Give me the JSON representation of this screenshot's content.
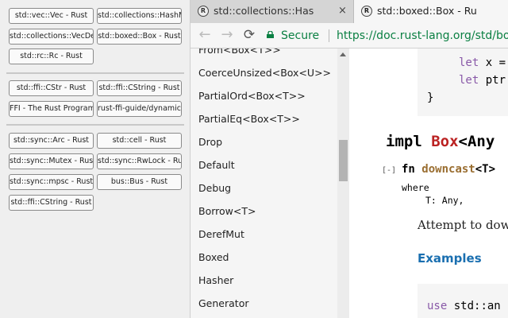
{
  "tab_manager": {
    "group1": [
      "std::vec::Vec - Rust",
      "std::collections::HashMap",
      "std::collections::VecDeque",
      "std::boxed::Box - Rust",
      "std::rc::Rc - Rust"
    ],
    "group2": [
      "std::ffi::CStr - Rust",
      "std::ffi::CString - Rust",
      "FFI - The Rust Programming",
      "rust-ffi-guide/dynamic_l"
    ],
    "group3": [
      "std::sync::Arc - Rust",
      "std::cell - Rust",
      "std::sync::Mutex - Rust",
      "std::sync::RwLock - Rust",
      "std::sync::mpsc - Rust",
      "bus::Bus - Rust",
      "std::ffi::CString - Rust"
    ]
  },
  "browser": {
    "tabs": [
      {
        "title": "std::collections::Has",
        "favicon": "R",
        "close": "×"
      },
      {
        "title": "std::boxed::Box - Ru",
        "favicon": "R",
        "close": "×"
      }
    ],
    "nav": {
      "back": "←",
      "forward": "→",
      "reload": "⟳"
    },
    "secure_label": "Secure",
    "url": "https://doc.rust-lang.org/std/boxed"
  },
  "doc_sidebar": {
    "items": [
      "From<Box<T>>",
      "CoerceUnsized<Box<U>>",
      "PartialOrd<Box<T>>",
      "PartialEq<Box<T>>",
      "Drop",
      "Default",
      "Debug",
      "Borrow<T>",
      "DerefMut",
      "Boxed",
      "Hasher",
      "Generator"
    ]
  },
  "content": {
    "code_top": {
      "line1_kw": "let",
      "line1_rest": " x =",
      "line2_kw": "let",
      "line2_rest": " ptr",
      "line3": "}"
    },
    "impl": {
      "kw": "impl",
      "type": "Box",
      "rest": "<Any"
    },
    "method": {
      "toggle": "[-]",
      "fn_kw": "fn",
      "name": "downcast",
      "generics": "<T>",
      "where": "where",
      "bound": "T: Any,"
    },
    "description": "Attempt to down",
    "examples_heading": "Examples",
    "example_code": {
      "kw": "use",
      "rest": " std::an"
    }
  },
  "colors": {
    "secure_green": "#0b8043",
    "keyword": "#8959a8",
    "type": "#ad448e",
    "fn_name": "#9a6e31",
    "heading_blue": "#1a6fb0"
  }
}
